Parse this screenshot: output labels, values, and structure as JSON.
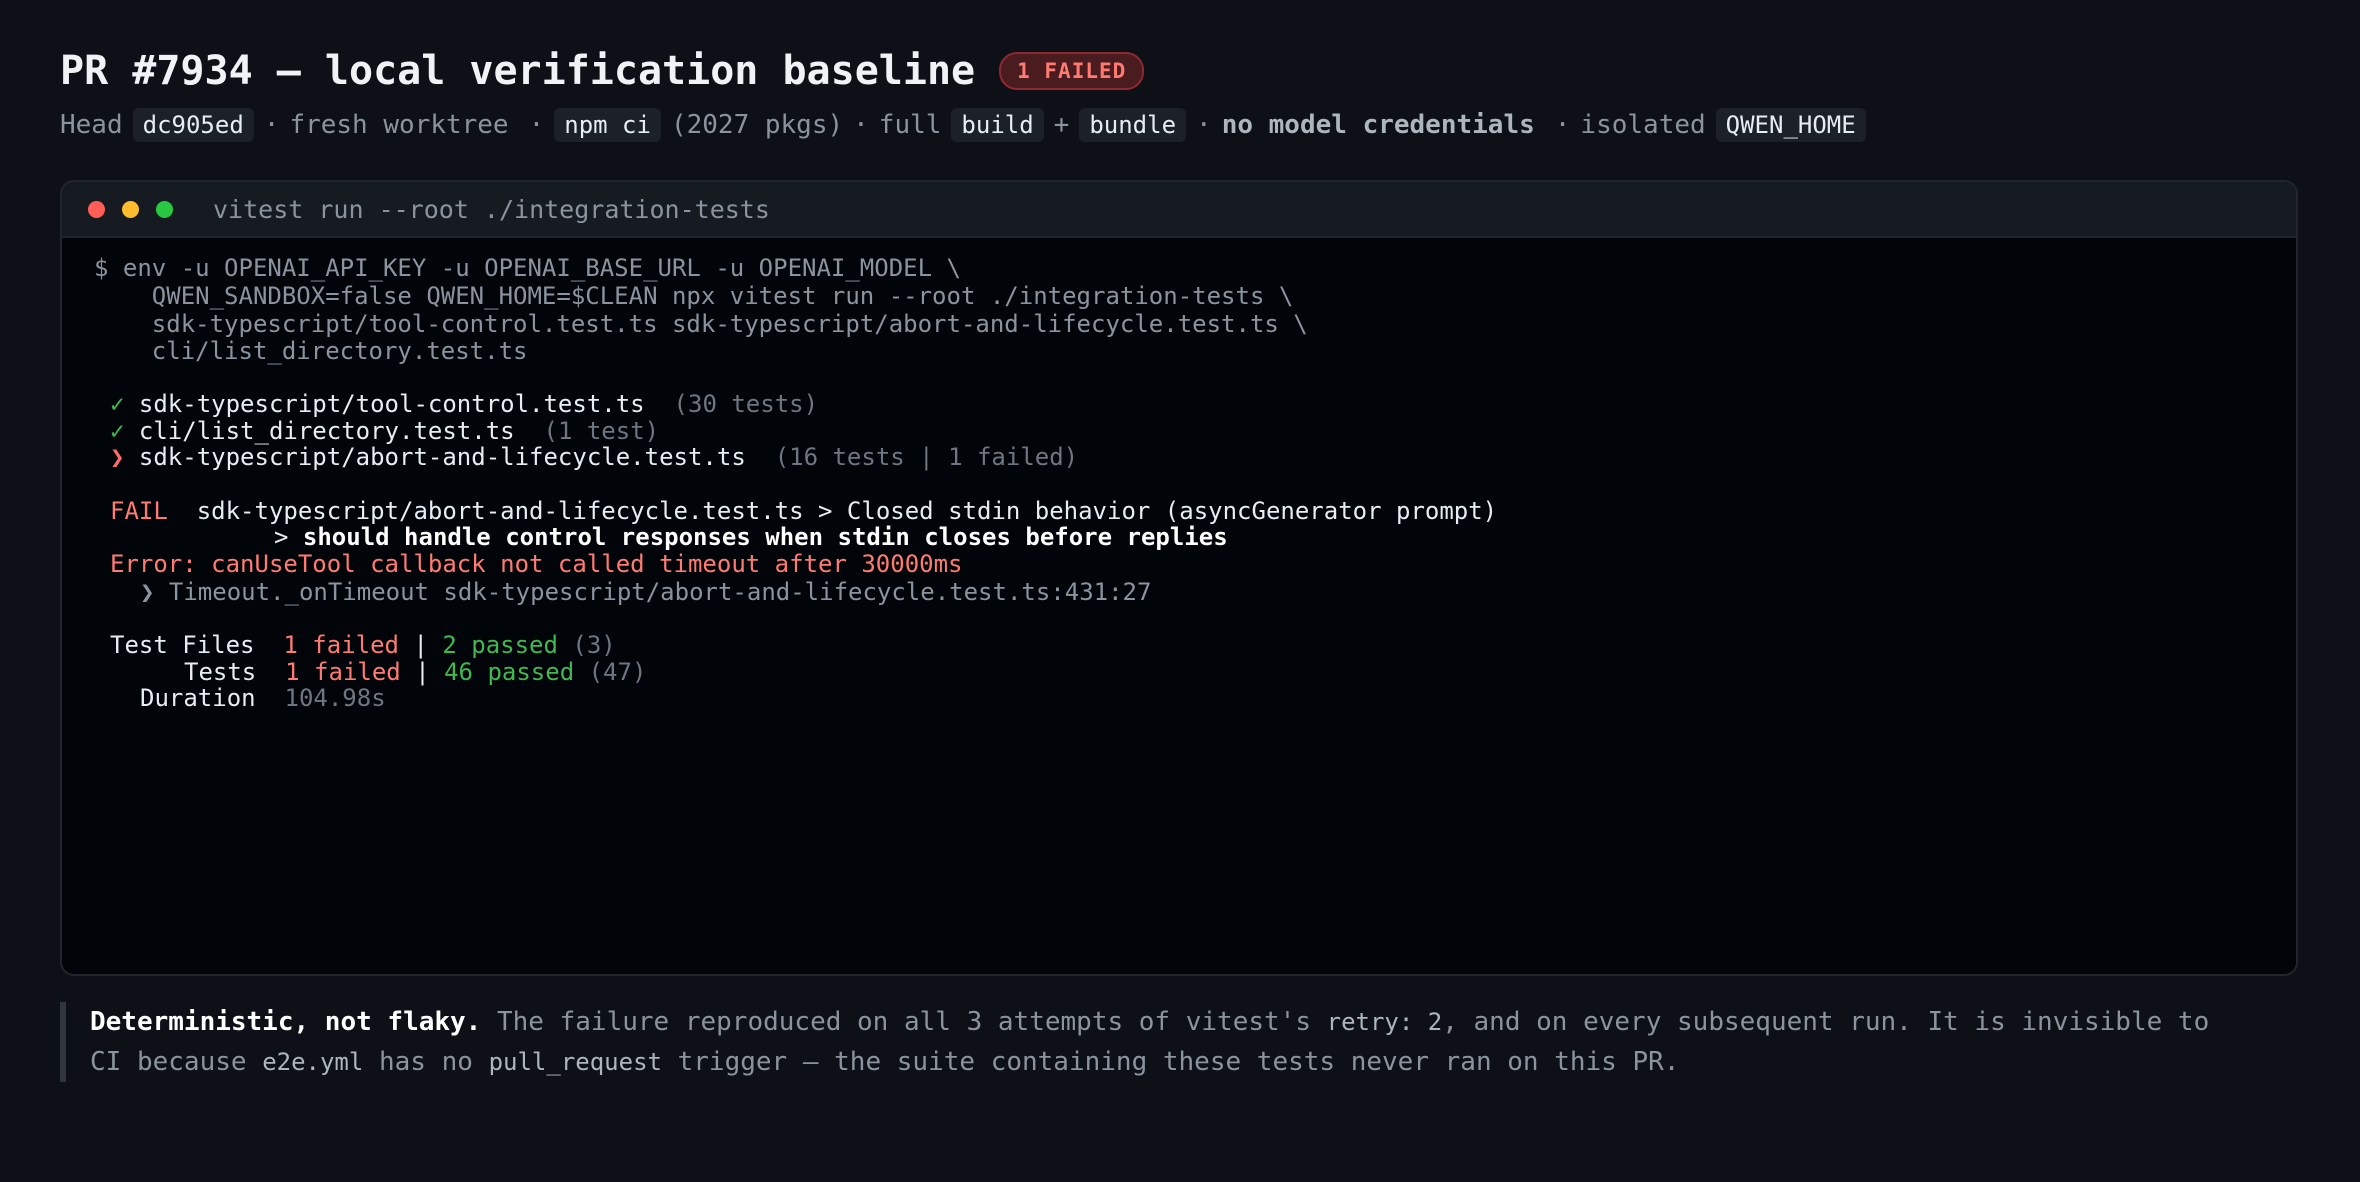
{
  "header": {
    "title": "PR #7934 — local verification baseline",
    "badge": "1 FAILED",
    "meta": {
      "head_label": "Head",
      "head_sha": "dc905ed",
      "sep1": "·",
      "worktree": "fresh worktree",
      "sep2": "·",
      "npm_ci": "npm ci",
      "pkgs": "(2027 pkgs)",
      "sep3": "·",
      "full": "full",
      "build": "build",
      "plus": "+",
      "bundle": "bundle",
      "sep4": "·",
      "no_creds": "no model credentials",
      "sep5": "·",
      "isolated": "isolated",
      "qwen_home": "QWEN_HOME"
    }
  },
  "terminal": {
    "title": "vitest run --root ./integration-tests",
    "command_lines": [
      "$ env -u OPENAI_API_KEY -u OPENAI_BASE_URL -u OPENAI_MODEL \\",
      "    QWEN_SANDBOX=false QWEN_HOME=$CLEAN npx vitest run --root ./integration-tests \\",
      "    sdk-typescript/tool-control.test.ts sdk-typescript/abort-and-lifecycle.test.ts \\",
      "    cli/list_directory.test.ts"
    ],
    "results": [
      {
        "mark": "✓",
        "file": "sdk-typescript/tool-control.test.ts",
        "count": "(30 tests)",
        "status": "pass"
      },
      {
        "mark": "✓",
        "file": "cli/list_directory.test.ts",
        "count": "(1 test)",
        "status": "pass"
      },
      {
        "mark": "❯",
        "file": "sdk-typescript/abort-and-lifecycle.test.ts",
        "count": "(16 tests | 1 failed)",
        "status": "fail"
      }
    ],
    "failure": {
      "label": "FAIL",
      "path": "sdk-typescript/abort-and-lifecycle.test.ts > Closed stdin behavior (asyncGenerator prompt)",
      "test_prefix": ">",
      "test_name": "should handle control responses when stdin closes before replies",
      "error": "Error: canUseTool callback not called timeout after 30000ms",
      "stack": "❯ Timeout._onTimeout sdk-typescript/abort-and-lifecycle.test.ts:431:27"
    },
    "summary": {
      "files_label": "Test Files",
      "files_failed": "1 failed",
      "files_sep": "|",
      "files_passed": "2 passed",
      "files_total": "(3)",
      "tests_label": "Tests",
      "tests_failed": "1 failed",
      "tests_sep": "|",
      "tests_passed": "46 passed",
      "tests_total": "(47)",
      "duration_label": "Duration",
      "duration_value": "104.98s"
    }
  },
  "note": {
    "lead": "Deterministic, not flaky.",
    "t1": " The failure reproduced on all 3 attempts of vitest's ",
    "c1": "retry: 2",
    "t2": ", and on every subsequent run. It is invisible to CI because ",
    "c2": "e2e.yml",
    "t3": " has no ",
    "c3": "pull_request",
    "t4": " trigger — the suite containing these tests never ran on this PR."
  },
  "colors": {
    "background": "#0d1117",
    "terminal_bg": "#010409",
    "pass": "#3fb950",
    "fail": "#ff7b72",
    "badge_bg": "#4a1b1f"
  },
  "icons": {
    "window_controls": [
      "close-dot",
      "minimize-dot",
      "maximize-dot"
    ]
  }
}
